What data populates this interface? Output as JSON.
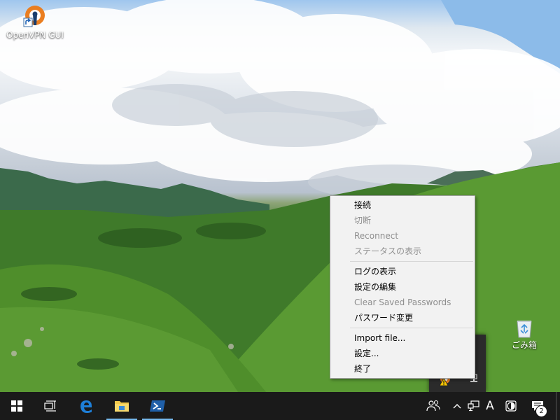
{
  "desktop": {
    "icons": [
      {
        "label": "OpenVPN GUI",
        "icon": "openvpn-shortcut-icon"
      },
      {
        "label": "ごみ箱",
        "icon": "recycle-bin-icon"
      }
    ]
  },
  "context_menu": {
    "items": [
      {
        "label": "接続",
        "enabled": true
      },
      {
        "label": "切断",
        "enabled": false
      },
      {
        "label": "Reconnect",
        "enabled": false
      },
      {
        "label": "ステータスの表示",
        "enabled": false
      },
      {
        "label": "ログの表示",
        "enabled": true
      },
      {
        "label": "設定の編集",
        "enabled": true
      },
      {
        "label": "Clear Saved Passwords",
        "enabled": false
      },
      {
        "label": "パスワード変更",
        "enabled": true
      },
      {
        "label": "Import file...",
        "enabled": true
      },
      {
        "label": "設定...",
        "enabled": true
      },
      {
        "label": "終了",
        "enabled": true
      }
    ]
  },
  "taskbar": {
    "apps": [
      "start-icon",
      "task-view-icon",
      "edge-icon",
      "file-explorer-icon",
      "powershell-icon"
    ],
    "tray": {
      "ime_mode": "A",
      "notification_count": "2"
    }
  },
  "colors": {
    "taskbar": "#1a1a1a",
    "menu_bg": "#f2f2f2",
    "accent": "#76b9ed",
    "edge_blue": "#1e7fd8",
    "openvpn_orange": "#ea7e20"
  }
}
